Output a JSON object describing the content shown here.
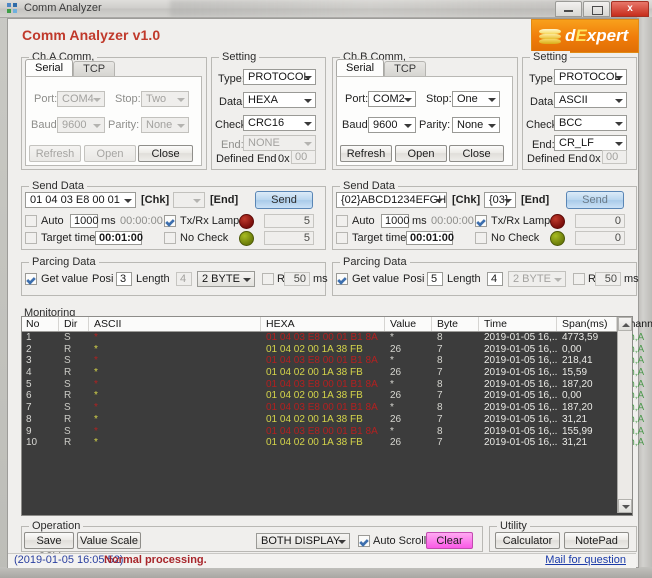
{
  "window": {
    "title": "Comm Analyzer",
    "app_title": "Comm Analyzer v1.0",
    "minimize": "",
    "maximize": "",
    "close": "x"
  },
  "logo": {
    "text_d": "d",
    "text_e": "E",
    "text_rest": "xpert"
  },
  "channel_a": {
    "group_label": "Ch,A Comm,",
    "tabs": [
      {
        "label": "Serial",
        "active": true
      },
      {
        "label": "TCP",
        "active": false
      }
    ],
    "port_label": "Port:",
    "port_value": "COM4",
    "stop_label": "Stop:",
    "stop_value": "Two",
    "baud_label": "Baud:",
    "baud_value": "9600",
    "parity_label": "Parity:",
    "parity_value": "None",
    "refresh": "Refresh",
    "open": "Open",
    "close": "Close"
  },
  "setting_a": {
    "group_label": "Setting",
    "type_label": "Type:",
    "type_value": "PROTOCOL",
    "data_label": "Data:",
    "data_value": "HEXA",
    "check_label": "Check:",
    "check_value": "CRC16",
    "end_label": "End:",
    "end_value": "NONE",
    "defined_end_label": "Defined End",
    "hex_prefix": "0x",
    "defined_end_value": "00"
  },
  "channel_b": {
    "group_label": "Ch,B Comm,",
    "tabs": [
      {
        "label": "Serial",
        "active": true
      },
      {
        "label": "TCP",
        "active": false
      }
    ],
    "port_label": "Port:",
    "port_value": "COM2",
    "stop_label": "Stop:",
    "stop_value": "One",
    "baud_label": "Baud:",
    "baud_value": "9600",
    "parity_label": "Parity:",
    "parity_value": "None",
    "refresh": "Refresh",
    "open": "Open",
    "close": "Close"
  },
  "setting_b": {
    "group_label": "Setting",
    "type_label": "Type:",
    "type_value": "PROTOCOL",
    "data_label": "Data:",
    "data_value": "ASCII",
    "check_label": "Check:",
    "check_value": "BCC",
    "end_label": "End:",
    "end_value": "CR_LF",
    "defined_end_label": "Defined End",
    "hex_prefix": "0x",
    "defined_end_value": "00"
  },
  "send_a": {
    "group_label": "Send Data",
    "data_value": "01 04 03 E8 00 01",
    "chk_label": "[Chk]",
    "chk_value": "",
    "end_label": "[End]",
    "send_button": "Send",
    "auto_label": "Auto",
    "auto_checked": false,
    "auto_ms_value": "1000",
    "ms_label": "ms",
    "elapsed_value": "00:00:00",
    "target_time_label": "Target time:",
    "target_checked": false,
    "target_time_value": "00:01:00",
    "lamp_label": "Tx/Rx Lamp",
    "lamp_checked": true,
    "nocheck_label": "No Check",
    "nocheck_checked": false,
    "tx_count": "5",
    "rx_count": "5"
  },
  "send_b": {
    "group_label": "Send Data",
    "data_value": "{02}ABCD1234EFGH",
    "chk_label": "[Chk]",
    "chk_value": "{03}",
    "end_label": "[End]",
    "send_button": "Send",
    "auto_label": "Auto",
    "auto_checked": false,
    "auto_ms_value": "1000",
    "ms_label": "ms",
    "elapsed_value": "00:00:00",
    "target_time_label": "Target time:",
    "target_checked": false,
    "target_time_value": "00:01:00",
    "lamp_label": "Tx/Rx Lamp",
    "lamp_checked": true,
    "nocheck_label": "No Check",
    "nocheck_checked": false,
    "tx_count": "0",
    "rx_count": "0"
  },
  "parcing_a": {
    "group_label": "Parcing Data",
    "get_value_label": "Get value",
    "get_value_checked": true,
    "posi_label": "Posi",
    "posi_value": "3",
    "length_label": "Length",
    "length_value": "4",
    "size_value": "2 BYTE",
    "rwt_label": "RWT",
    "rwt_checked": false,
    "rwt_value": "50",
    "ms_label": "ms"
  },
  "parcing_b": {
    "group_label": "Parcing Data",
    "get_value_label": "Get value",
    "get_value_checked": true,
    "posi_label": "Posi",
    "posi_value": "5",
    "length_label": "Length",
    "length_value": "4",
    "size_value": "2 BYTE",
    "rwt_label": "RWT",
    "rwt_checked": false,
    "rwt_value": "50",
    "ms_label": "ms"
  },
  "monitoring": {
    "group_label": "Monitoring",
    "columns": [
      "No",
      "Dir",
      "ASCII",
      "HEXA",
      "Value",
      "Byte",
      "Time",
      "Span(ms)",
      "Channel"
    ],
    "rows": [
      {
        "no": "1",
        "dir": "S",
        "ascii": "*",
        "hexa": "01 04 03 E8 00 01 B1 8A",
        "value": "*",
        "byte": "8",
        "time": "2019-01-05 16,..",
        "span": "4773,59",
        "channel": "Ch,A",
        "kind": "send"
      },
      {
        "no": "2",
        "dir": "R",
        "ascii": "*",
        "hexa": "01 04 02 00 1A 38 FB",
        "value": "26",
        "byte": "7",
        "time": "2019-01-05 16,..",
        "span": "0,00",
        "channel": "Ch,A",
        "kind": "recv"
      },
      {
        "no": "3",
        "dir": "S",
        "ascii": "*",
        "hexa": "01 04 03 E8 00 01 B1 8A",
        "value": "*",
        "byte": "8",
        "time": "2019-01-05 16,..",
        "span": "218,41",
        "channel": "Ch,A",
        "kind": "send"
      },
      {
        "no": "4",
        "dir": "R",
        "ascii": "*",
        "hexa": "01 04 02 00 1A 38 FB",
        "value": "26",
        "byte": "7",
        "time": "2019-01-05 16,..",
        "span": "15,59",
        "channel": "Ch,A",
        "kind": "recv"
      },
      {
        "no": "5",
        "dir": "S",
        "ascii": "*",
        "hexa": "01 04 03 E8 00 01 B1 8A",
        "value": "*",
        "byte": "8",
        "time": "2019-01-05 16,..",
        "span": "187,20",
        "channel": "Ch,A",
        "kind": "send"
      },
      {
        "no": "6",
        "dir": "R",
        "ascii": "*",
        "hexa": "01 04 02 00 1A 38 FB",
        "value": "26",
        "byte": "7",
        "time": "2019-01-05 16,..",
        "span": "0,00",
        "channel": "Ch,A",
        "kind": "recv"
      },
      {
        "no": "7",
        "dir": "S",
        "ascii": "*",
        "hexa": "01 04 03 E8 00 01 B1 8A",
        "value": "*",
        "byte": "8",
        "time": "2019-01-05 16,..",
        "span": "187,20",
        "channel": "Ch,A",
        "kind": "send"
      },
      {
        "no": "8",
        "dir": "R",
        "ascii": "*",
        "hexa": "01 04 02 00 1A 38 FB",
        "value": "26",
        "byte": "7",
        "time": "2019-01-05 16,..",
        "span": "31,21",
        "channel": "Ch,A",
        "kind": "recv"
      },
      {
        "no": "9",
        "dir": "S",
        "ascii": "*",
        "hexa": "01 04 03 E8 00 01 B1 8A",
        "value": "*",
        "byte": "8",
        "time": "2019-01-05 16,..",
        "span": "155,99",
        "channel": "Ch,A",
        "kind": "send"
      },
      {
        "no": "10",
        "dir": "R",
        "ascii": "*",
        "hexa": "01 04 02 00 1A 38 FB",
        "value": "26",
        "byte": "7",
        "time": "2019-01-05 16,..",
        "span": "31,21",
        "channel": "Ch,A",
        "kind": "recv"
      }
    ]
  },
  "operation": {
    "group_label": "Operation",
    "save_csv": "Save CSV",
    "value_scale": "Value Scale",
    "display_mode": "BOTH DISPLAY",
    "auto_scroll_label": "Auto Scroll",
    "auto_scroll_checked": true,
    "clear": "Clear"
  },
  "utility": {
    "group_label": "Utility",
    "calculator": "Calculator",
    "notepad": "NotePad"
  },
  "status": {
    "timestamp": "(2019-01-05 16:05:52)",
    "message": "Normal processing.",
    "mail_link": "Mail for question"
  },
  "colors": {
    "accent_red": "#c0392b",
    "logo_orange": "#f07c0a",
    "send_row": "#b32020",
    "recv_row": "#d4d44a",
    "channel_green": "#4f9a4f",
    "clear_pink": "#f95ae6"
  }
}
